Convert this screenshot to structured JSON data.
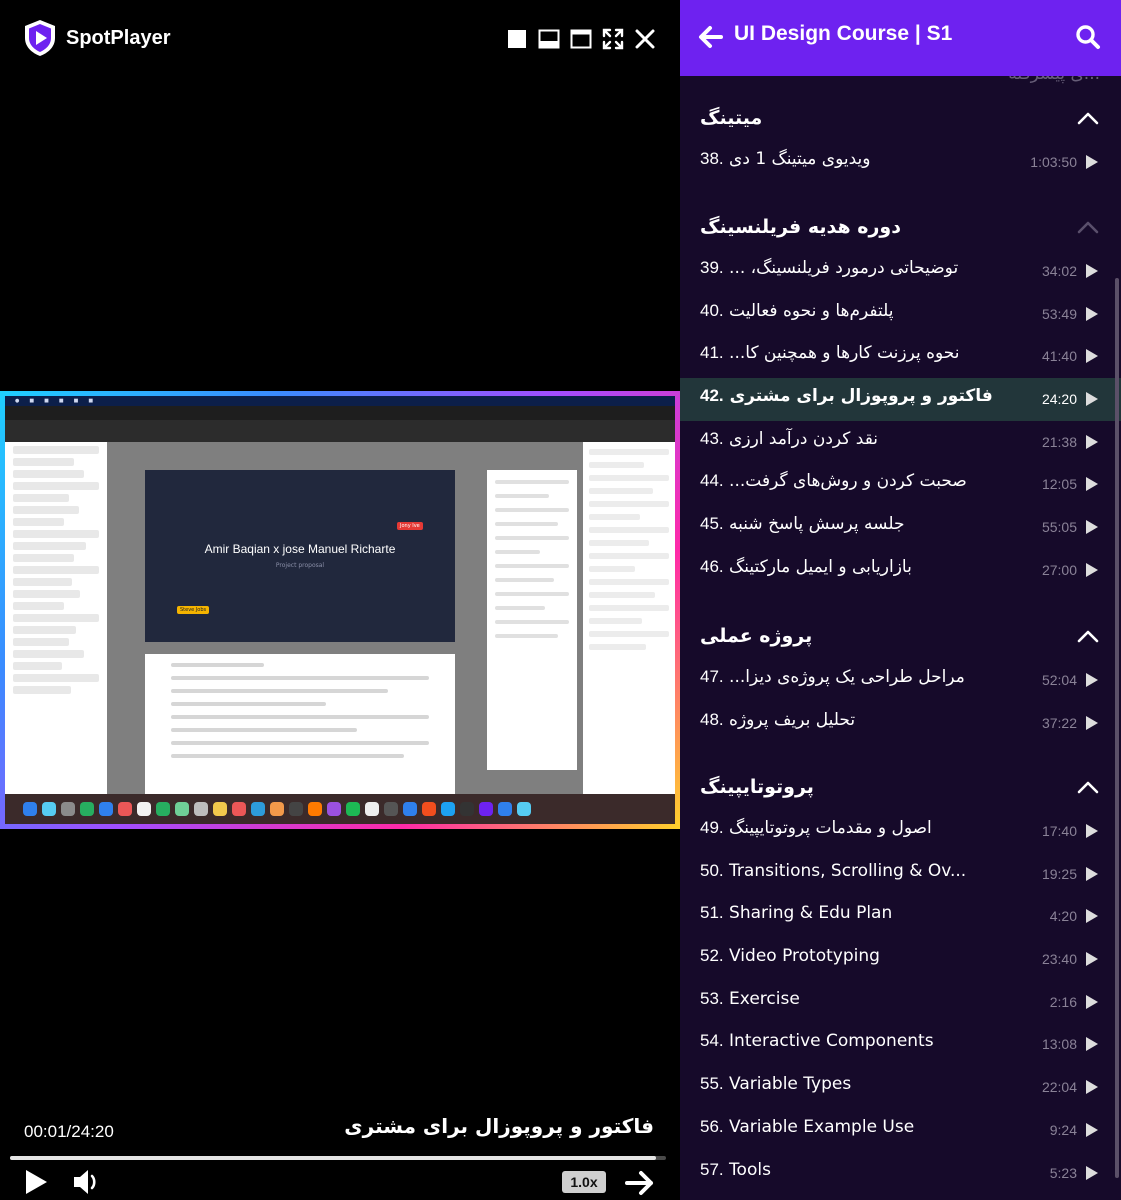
{
  "app": {
    "name": "SpotPlayer"
  },
  "player": {
    "current_time": "00:01/24:20",
    "now_playing_title": "فاکتور و پروپوزال برای مشتری",
    "progress": 0.0007,
    "speed": "1.0x",
    "video_preview": {
      "slide_title": "Amir Baqian x jose Manuel Richarte",
      "slide_subtitle": "Project proposal",
      "cursor_label_1": "Steve Jobs",
      "cursor_label_2": "Jony Ive"
    }
  },
  "sidebar": {
    "course_title": "UI Design Course | S1",
    "peek_text": "...ی پیشرفته",
    "sections": [
      {
        "title": "میتینگ",
        "expanded": true,
        "lessons": [
          {
            "num": "38.",
            "title": "ویدیوی میتینگ 1 دی",
            "duration": "1:03:50",
            "rtl": true
          }
        ]
      },
      {
        "title": "دوره هدیه فریلنسینگ",
        "expanded": true,
        "lessons": [
          {
            "num": "39.",
            "title": "توضیحاتی درمورد فریلنسینگ، ...",
            "duration": "34:02",
            "rtl": true
          },
          {
            "num": "40.",
            "title": "پلتفرم‌ها و نحوه فعالیت",
            "duration": "53:49",
            "rtl": true
          },
          {
            "num": "41.",
            "title": "نحوه پرزنت کارها و همچنین کا...",
            "duration": "41:40",
            "rtl": true
          },
          {
            "num": "42.",
            "title": "فاکتور و پروپوزال برای مشتری",
            "duration": "24:20",
            "rtl": true,
            "active": true
          },
          {
            "num": "43.",
            "title": "نقد کردن درآمد ارزی",
            "duration": "21:38",
            "rtl": true
          },
          {
            "num": "44.",
            "title": "صحبت کردن و روش‌های گرفت...",
            "duration": "12:05",
            "rtl": true
          },
          {
            "num": "45.",
            "title": "جلسه پرسش پاسخ شنبه",
            "duration": "55:05",
            "rtl": true
          },
          {
            "num": "46.",
            "title": "بازاریابی و ایمیل مارکتینگ",
            "duration": "27:00",
            "rtl": true
          }
        ]
      },
      {
        "title": "پروژه عملی",
        "expanded": true,
        "lessons": [
          {
            "num": "47.",
            "title": "مراحل طراحی یک پروژه‌ی دیزا...",
            "duration": "52:04",
            "rtl": true
          },
          {
            "num": "48.",
            "title": "تحلیل بریف پروژه",
            "duration": "37:22",
            "rtl": true
          }
        ]
      },
      {
        "title": "پروتوتایپینگ",
        "expanded": true,
        "lessons": [
          {
            "num": "49.",
            "title": "اصول و مقدمات پروتوتایپینگ",
            "duration": "17:40",
            "rtl": true
          },
          {
            "num": "50.",
            "title": "Transitions, Scrolling & Ov...",
            "duration": "19:25"
          },
          {
            "num": "51.",
            "title": "Sharing & Edu Plan",
            "duration": "4:20"
          },
          {
            "num": "52.",
            "title": "Video Prototyping",
            "duration": "23:40"
          },
          {
            "num": "53.",
            "title": "Exercise",
            "duration": "2:16"
          },
          {
            "num": "54.",
            "title": "Interactive Components",
            "duration": "13:08"
          },
          {
            "num": "55.",
            "title": "Variable Types",
            "duration": "22:04"
          },
          {
            "num": "56.",
            "title": "Variable Example Use",
            "duration": "9:24"
          },
          {
            "num": "57.",
            "title": "Tools",
            "duration": "5:23"
          }
        ]
      }
    ]
  },
  "colors": {
    "accent": "#6e22f0",
    "sidebar_bg": "#160a2a",
    "active_row": "#22363a"
  }
}
